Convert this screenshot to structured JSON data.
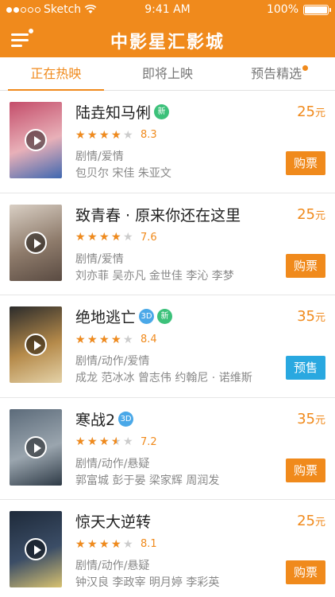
{
  "status_bar": {
    "carrier": "Sketch",
    "time": "9:41 AM",
    "battery_text": "100%",
    "battery_level": 1.0,
    "signal_bars": 2
  },
  "nav": {
    "title": "中影星汇影城",
    "menu_icon": "menu-icon"
  },
  "tabs": [
    {
      "label": "正在热映",
      "active": true
    },
    {
      "label": "即将上映",
      "active": false
    },
    {
      "label": "预告精选",
      "active": false,
      "has_dot": true
    }
  ],
  "colors": {
    "brand": "#F08A1C",
    "presale": "#29A8E0",
    "tag_3d": "#4AA8E8",
    "tag_new": "#3CC17A"
  },
  "movies": [
    {
      "title": "陆垚知马俐",
      "tags": [
        "新"
      ],
      "rating": 4,
      "score": "8.3",
      "genre": "剧情/爱情",
      "cast": "包贝尔 宋佳 朱亚文",
      "price": "25",
      "price_unit": "元",
      "action": "购票",
      "action_type": "buy",
      "poster_colors": [
        "#c44d6a",
        "#e8b0b8",
        "#3f67b0"
      ]
    },
    {
      "title": "致青春 · 原来你还在这里",
      "tags": [],
      "rating": 4,
      "score": "7.6",
      "genre": "剧情/爱情",
      "cast": "刘亦菲 吴亦凡 金世佳 李沁 李梦",
      "price": "25",
      "price_unit": "元",
      "action": "购票",
      "action_type": "buy",
      "poster_colors": [
        "#d9cfc4",
        "#8e7b6b",
        "#5a4b42"
      ]
    },
    {
      "title": "绝地逃亡",
      "tags": [
        "3D",
        "新"
      ],
      "rating": 4,
      "score": "8.4",
      "genre": "剧情/动作/爱情",
      "cast": "成龙 范冰冰 曾志伟 约翰尼 · 诺维斯",
      "price": "35",
      "price_unit": "元",
      "action": "预售",
      "action_type": "presale",
      "poster_colors": [
        "#2b2b2b",
        "#b58a4a",
        "#e4d2a8"
      ]
    },
    {
      "title": "寒战2",
      "tags": [
        "3D"
      ],
      "rating": 3.5,
      "score": "7.2",
      "genre": "剧情/动作/悬疑",
      "cast": "郭富城 彭于晏 梁家辉 周润发",
      "price": "35",
      "price_unit": "元",
      "action": "购票",
      "action_type": "buy",
      "poster_colors": [
        "#5c6b7a",
        "#9aa5ae",
        "#2e3a46"
      ]
    },
    {
      "title": "惊天大逆转",
      "tags": [],
      "rating": 4,
      "score": "8.1",
      "genre": "剧情/动作/悬疑",
      "cast": "钟汉良 李政宰 明月婷 李彩英",
      "price": "25",
      "price_unit": "元",
      "action": "购票",
      "action_type": "buy",
      "poster_colors": [
        "#1e2a3a",
        "#3b4d66",
        "#d8c270"
      ]
    }
  ]
}
